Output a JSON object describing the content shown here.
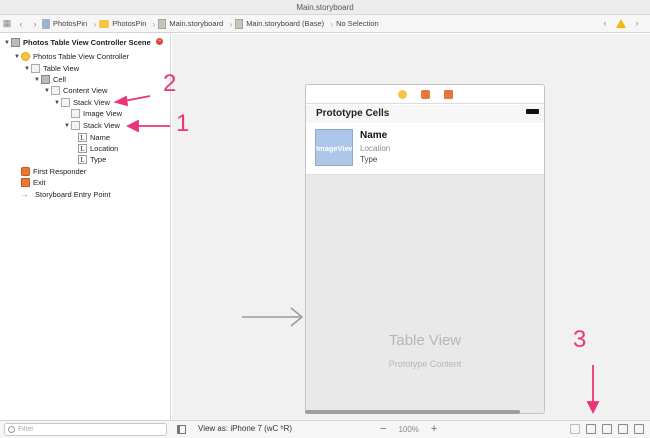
{
  "window": {
    "title": "Main.storyboard"
  },
  "jumpbar": {
    "crumbs": [
      "PhotosPin",
      "PhotosPin",
      "Main.storyboard",
      "Main.storyboard (Base)",
      "No Selection"
    ]
  },
  "outline": {
    "scene": "Photos Table View Controller Scene",
    "items": {
      "vc": "Photos Table View Controller",
      "table_view": "Table View",
      "cell": "Cell",
      "content_view": "Content View",
      "stack_view_outer": "Stack View",
      "image_view": "Image View",
      "stack_view_inner": "Stack View",
      "name": "Name",
      "location": "Location",
      "type": "Type",
      "first_responder": "First Responder",
      "exit": "Exit",
      "entry_point": "Storyboard Entry Point"
    },
    "label_glyph": "L"
  },
  "canvas": {
    "prototype_header": "Prototype Cells",
    "cell": {
      "image_label": "ImageView",
      "name": "Name",
      "location": "Location",
      "type": "Type"
    },
    "table_title": "Table View",
    "table_subtitle": "Prototype Content"
  },
  "bottombar": {
    "filter_placeholder": "Filter",
    "view_as": "View as: iPhone 7 (ᴡC ʰR)",
    "zoom": "100%",
    "zoom_minus": "−",
    "zoom_plus": "+"
  },
  "annotations": {
    "one": "1",
    "two": "2",
    "three": "3"
  },
  "colors": {
    "accent": "#e9357a",
    "warning": "#f2b90c",
    "imageview": "#aec7e8"
  }
}
